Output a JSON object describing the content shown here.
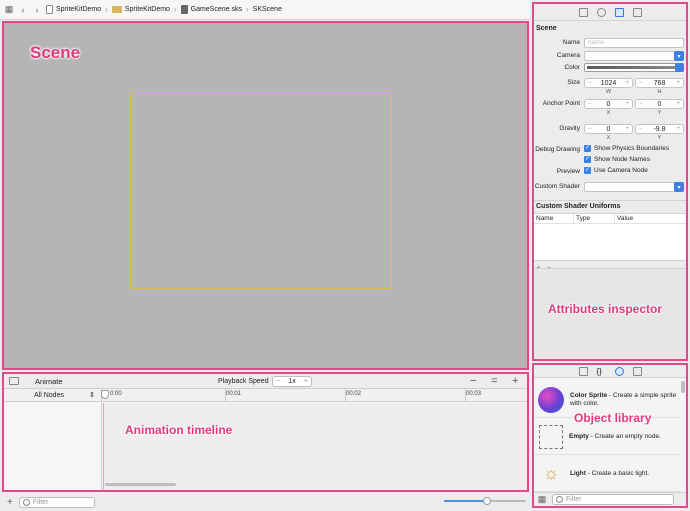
{
  "breadcrumb": {
    "items": [
      "SpriteKitDemo",
      "SpriteKitDemo",
      "GameScene.sks",
      "SKScene"
    ]
  },
  "annotations": {
    "scene": "Scene",
    "timeline": "Animation timeline",
    "inspector": "Attributes inspector",
    "library": "Object library"
  },
  "inspector": {
    "section_title": "Scene",
    "name_label": "Name",
    "name_placeholder": "name",
    "camera_label": "Camera",
    "color_label": "Color",
    "size_label": "Size",
    "size_w": "1024",
    "size_h": "768",
    "w_caption": "W",
    "h_caption": "H",
    "anchor_label": "Anchor Point",
    "anchor_x": "0",
    "anchor_y": "0",
    "x_caption": "X",
    "y_caption": "Y",
    "gravity_label": "Gravity",
    "gravity_x": "0",
    "gravity_y": "-9.8",
    "debug_label": "Debug Drawing",
    "show_physics": "Show Physics Boundaries",
    "show_node_names": "Show Node Names",
    "preview_label": "Preview",
    "use_camera_node": "Use Camera Node",
    "custom_shader_label": "Custom Shader",
    "uniforms_title": "Custom Shader Uniforms",
    "uniform_columns": [
      "Name",
      "Type",
      "Value"
    ]
  },
  "timeline": {
    "animate_label": "Animate",
    "playback_speed_label": "Playback Speed",
    "playback_speed_value": "1x",
    "node_filter": "All Nodes",
    "ticks": [
      "0:00",
      "00:01",
      "00:02",
      "00:03"
    ]
  },
  "bottom": {
    "filter_placeholder": "Filter",
    "zoom_level": 0.52
  },
  "library": {
    "items": [
      {
        "title": "Color Sprite",
        "desc": " - Create a simple sprite with color."
      },
      {
        "title": "Empty",
        "desc": " - Create an empty node."
      },
      {
        "title": "Light",
        "desc": " - Create a basic light."
      }
    ],
    "filter_placeholder": "Filter"
  },
  "colors": {
    "annotation": "#e1397e",
    "accent": "#3b82e0",
    "scene_bg": "#b5b5b5",
    "scene_frame": "#e0ba55"
  }
}
